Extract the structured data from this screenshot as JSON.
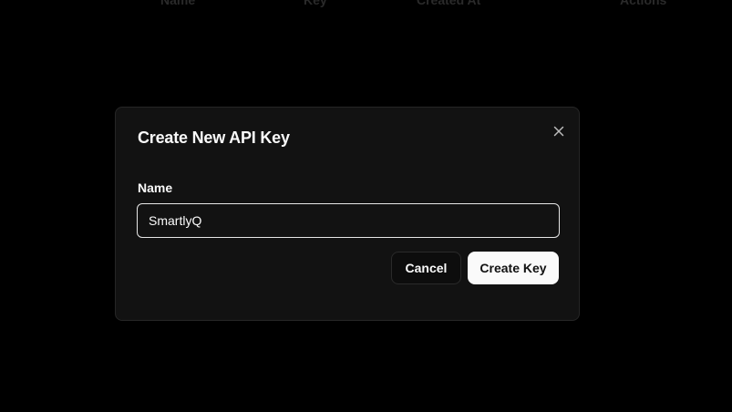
{
  "table": {
    "headers": {
      "name": "Name",
      "key": "Key",
      "created_at": "Created At",
      "actions": "Actions"
    }
  },
  "dialog": {
    "title": "Create New API Key",
    "close_icon": "close-icon",
    "name_field": {
      "label": "Name",
      "value": "SmartlyQ"
    },
    "buttons": {
      "cancel_label": "Cancel",
      "create_label": "Create Key"
    }
  },
  "colors": {
    "overlay": "#000000",
    "dialog_background": "#121212",
    "dialog_border": "#262626",
    "primary_button": "#fafafa",
    "text": "#fafafa"
  }
}
